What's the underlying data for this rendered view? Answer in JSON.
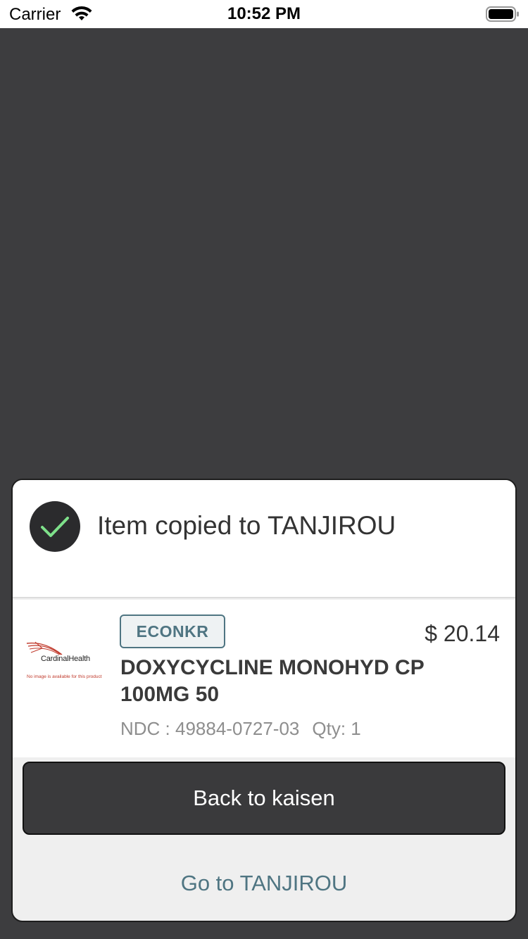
{
  "status_bar": {
    "carrier": "Carrier",
    "time": "10:52 PM",
    "wifi_icon": "wifi-icon",
    "battery_icon": "battery-icon"
  },
  "modal": {
    "title": "Item copied to TANJIROU",
    "status_icon": "checkmark-circle-icon",
    "product": {
      "image_logo_text": "CardinalHealth",
      "image_note": "No image is available for this product",
      "vendor": "ECONKR",
      "price": "$ 20.14",
      "name": "DOXYCYCLINE MONOHYD CP 100MG 50",
      "ndc": "NDC : 49884-0727-03",
      "qty": "Qty: 1"
    },
    "back_label": "Back to kaisen",
    "goto_label": "Go to TANJIROU"
  },
  "colors": {
    "backdrop": "#3d3d3f",
    "accent": "#4f7582",
    "check_green": "#7ee08a",
    "primary_button": "#3a3a3c"
  }
}
